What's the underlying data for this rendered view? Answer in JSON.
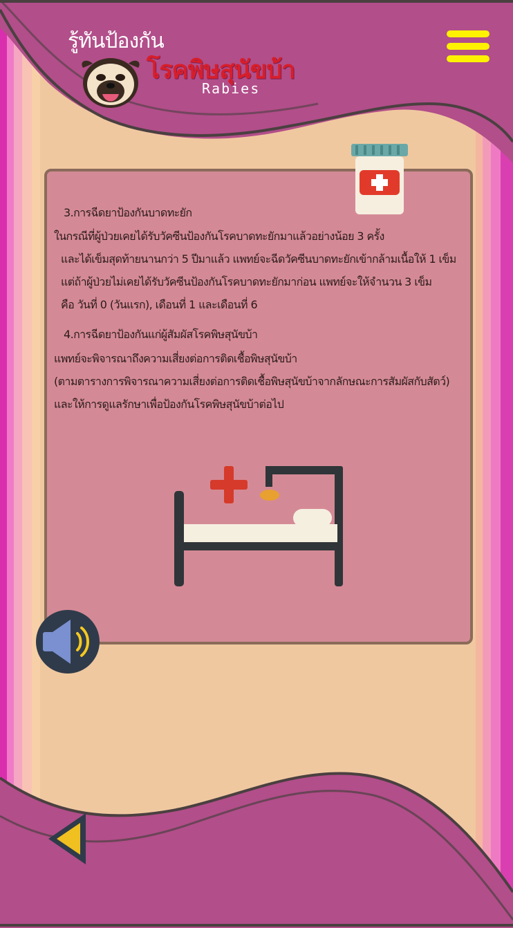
{
  "header": {
    "title_line1": "รู้ทันป้องกัน",
    "title_line2": "โรคพิษสุนัขบ้า",
    "title_en": "Rabies"
  },
  "menu": {
    "icon": "hamburger-menu-icon",
    "color": "#fff200"
  },
  "content": {
    "section3": {
      "heading": "3.การฉีดยาป้องกันบาดทะยัก",
      "lines": [
        "ในกรณีที่ผู้ป่วยเคยได้รับวัคซีนป้องกันโรคบาดทะยักมาแล้วอย่างน้อย 3 ครั้ง",
        "และได้เข็มสุดท้ายนานกว่า 5 ปีมาแล้ว แพทย์จะฉีดวัคซีนบาดทะยักเข้ากล้ามเนื้อให้ 1 เข็ม",
        "แต่ถ้าผู้ป่วยไม่เคยได้รับวัคซีนป้องกันโรคบาดทะยักมาก่อน แพทย์จะให้จำนวน 3 เข็ม",
        "คือ วันที่ 0 (วันแรก), เดือนที่ 1 และเดือนที่ 6"
      ]
    },
    "section4": {
      "heading": "4.การฉีดยาป้องกันแก่ผู้สัมผัสโรคพิษสุนัขบ้า",
      "lines": [
        "แพทย์จะพิจารณาถึงความเสี่ยงต่อการติดเชื้อพิษสุนัขบ้า",
        "(ตามตารางการพิจารณาความเสี่ยงต่อการติดเชื้อพิษสุนัขบ้าจากลักษณะการสัมผัสกับสัตว์)",
        "และให้การดูแลรักษาเพื่อป้องกันโรคพิษสุนัขบ้าต่อไป"
      ]
    }
  },
  "icons": {
    "bottle": "medicine-bottle-icon",
    "bed": "hospital-bed-icon",
    "speaker": "speaker-icon",
    "back": "back-arrow-icon"
  },
  "colors": {
    "magenta": "#b24e8a",
    "peach": "#f0c8a0",
    "card": "#d48a96",
    "red": "#d81e2a",
    "yellow": "#fff200"
  }
}
